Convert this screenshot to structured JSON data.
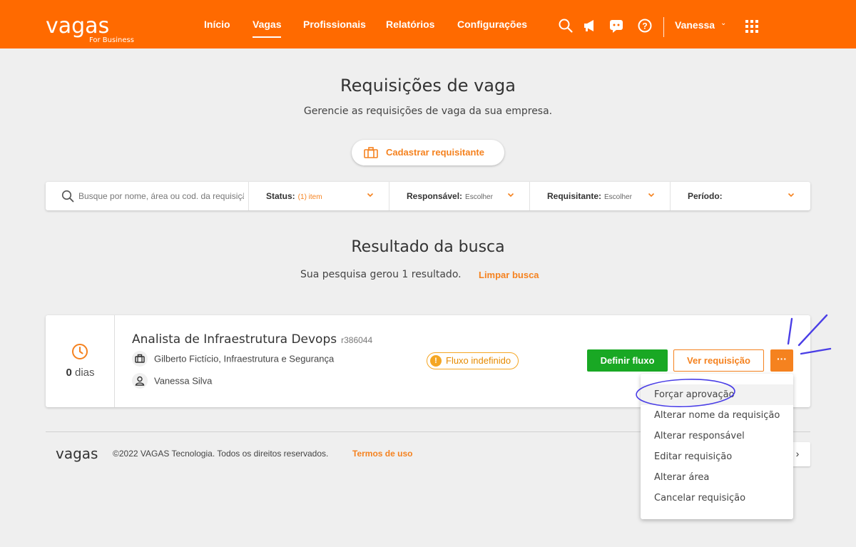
{
  "header": {
    "logo": "vagas",
    "logo_sub": "For Business",
    "nav": [
      "Início",
      "Vagas",
      "Profissionais",
      "Relatórios",
      "Configurações"
    ],
    "active_nav": "Vagas",
    "user": "Vanessa",
    "icons": [
      "search-icon",
      "megaphone-icon",
      "chat-icon",
      "help-icon",
      "apps-grid-icon"
    ]
  },
  "page": {
    "title": "Requisições de vaga",
    "subtitle": "Gerencie as requisições de vaga da sua empresa.",
    "cadastrar_label": "Cadastrar requisitante"
  },
  "filters": {
    "search_placeholder": "Busque por nome, área ou cod. da requisição",
    "status_label": "Status:",
    "status_value": "(1) item",
    "responsavel_label": "Responsável:",
    "responsavel_value": "Escolher",
    "requisitante_label": "Requisitante:",
    "requisitante_value": "Escolher",
    "periodo_label": "Período:"
  },
  "results": {
    "title": "Resultado da busca",
    "summary": "Sua pesquisa gerou 1 resultado.",
    "clear": "Limpar busca"
  },
  "card": {
    "days_num": "0",
    "days_label": "dias",
    "title": "Analista de Infraestrutura Devops",
    "code": "r386044",
    "department": "Gilberto Fictício, Infraestrutura e Segurança",
    "person": "Vanessa Silva",
    "badge": "Fluxo indefinido",
    "btn_define": "Definir fluxo",
    "btn_view": "Ver requisição",
    "btn_more": "···"
  },
  "menu": {
    "items": [
      "Forçar aprovação",
      "Alterar nome da requisição",
      "Alterar responsável",
      "Editar requisição",
      "Alterar área",
      "Cancelar requisição"
    ],
    "highlighted": "Forçar aprovação"
  },
  "footer": {
    "logo": "vagas",
    "copyright": "©2022 VAGAS Tecnologia. Todos os direitos reservados.",
    "terms": "Termos de uso",
    "pager": "›"
  },
  "colors": {
    "brand": "#ff6a00",
    "accent": "#f5821f",
    "success": "#19a824",
    "annotation": "#4a3ee6"
  }
}
